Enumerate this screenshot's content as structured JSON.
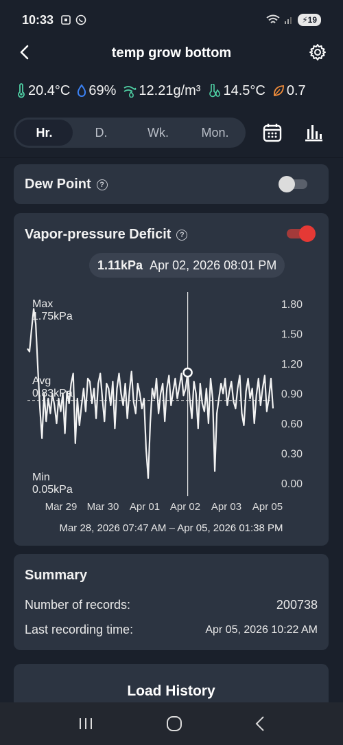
{
  "status_bar": {
    "time": "10:33",
    "battery": "19"
  },
  "header": {
    "title": "temp grow bottom"
  },
  "metrics": [
    {
      "icon": "thermometer-icon",
      "value": "20.4°C",
      "color": "#4fd1a5"
    },
    {
      "icon": "humidity-drop-icon",
      "value": "69%",
      "color": "#3b82f6"
    },
    {
      "icon": "absolute-humidity-icon",
      "value": "12.21g/m³",
      "color": "#4fd1a5"
    },
    {
      "icon": "dew-point-icon",
      "value": "14.5°C",
      "color": "#4fd1a5"
    },
    {
      "icon": "leaf-icon",
      "value": "0.7",
      "color": "#f08c3a"
    }
  ],
  "tabs": [
    {
      "label": "Hr.",
      "active": true
    },
    {
      "label": "D.",
      "active": false
    },
    {
      "label": "Wk.",
      "active": false
    },
    {
      "label": "Mon.",
      "active": false
    }
  ],
  "dew_point": {
    "label": "Dew Point",
    "enabled": false
  },
  "vpd": {
    "label": "Vapor-pressure Deficit",
    "enabled": true,
    "tooltip_value": "1.11kPa",
    "tooltip_time": "Apr 02, 2026 08:01 PM",
    "max_label": "Max",
    "max_value": "1.75kPa",
    "avg_label": "Avg",
    "avg_value": "0.83kPa",
    "min_label": "Min",
    "min_value": "0.05kPa",
    "range": "Mar 28, 2026 07:47 AM – Apr 05, 2026 01:38 PM"
  },
  "chart_data": {
    "type": "line",
    "title": "",
    "xlabel": "",
    "ylabel": "",
    "x_tick_labels": [
      "Mar 29",
      "Mar 30",
      "Apr 01",
      "Apr 02",
      "Apr 03",
      "Apr 05"
    ],
    "y_tick_labels": [
      "1.80",
      "1.50",
      "1.20",
      "0.90",
      "0.60",
      "0.30",
      "0.00"
    ],
    "ylim": [
      0,
      1.8
    ],
    "grid": false,
    "average_line": 0.83,
    "selected_point": {
      "x": "Apr 02, 2026 08:01 PM",
      "y": 1.11
    },
    "series": [
      {
        "values": [
          1.35,
          1.32,
          1.55,
          1.75,
          1.6,
          1.15,
          0.75,
          0.45,
          0.9,
          0.62,
          0.85,
          0.7,
          0.9,
          0.78,
          0.6,
          0.85,
          0.72,
          0.9,
          0.5,
          0.92,
          0.8,
          1.0,
          1.1,
          0.4,
          0.85,
          0.58,
          0.78,
          0.95,
          0.72,
          1.05,
          1.02,
          0.8,
          0.95,
          0.65,
          1.0,
          1.1,
          0.85,
          0.62,
          1.0,
          0.95,
          0.78,
          1.02,
          0.55,
          0.95,
          1.1,
          0.9,
          0.78,
          1.0,
          0.65,
          0.92,
          1.12,
          0.82,
          0.7,
          1.0,
          0.9,
          0.75,
          0.85,
          0.35,
          0.05,
          0.6,
          0.95,
          0.85,
          1.05,
          0.7,
          0.9,
          1.0,
          0.62,
          0.95,
          1.08,
          0.78,
          0.92,
          1.05,
          0.85,
          0.97,
          1.1,
          0.88,
          0.95,
          1.11,
          0.85,
          0.65,
          1.02,
          0.9,
          0.55,
          1.0,
          0.8,
          0.72,
          0.95,
          0.6,
          1.05,
          0.85,
          0.12,
          0.7,
          0.85,
          1.0,
          0.9,
          1.05,
          0.78,
          0.92,
          1.02,
          0.82,
          0.75,
          0.95,
          1.08,
          0.7,
          0.58,
          0.92,
          1.05,
          0.85,
          0.95,
          0.6,
          0.88,
          1.05,
          0.78,
          0.95,
          1.08,
          0.72,
          0.85,
          1.05,
          0.75
        ]
      }
    ]
  },
  "summary": {
    "title": "Summary",
    "records_label": "Number of records:",
    "records_value": "200738",
    "last_label": "Last recording time:",
    "last_value": "Apr 05, 2026 10:22 AM"
  },
  "load_history": {
    "label": "Load History"
  }
}
